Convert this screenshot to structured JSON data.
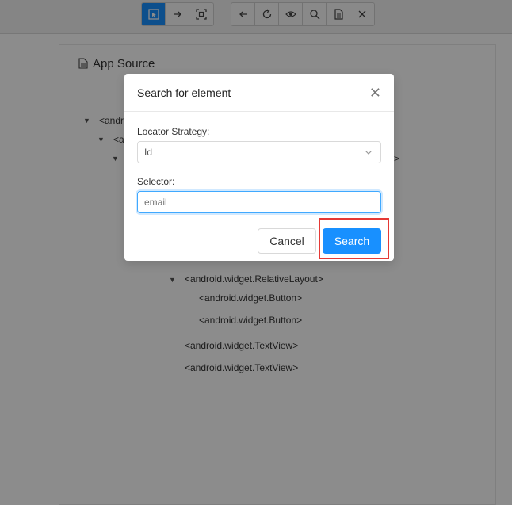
{
  "toolbar": {
    "group1": [
      "select-element-icon",
      "swipe-icon",
      "tap-coordinates-icon"
    ],
    "group2": [
      "back-icon",
      "refresh-icon",
      "show-icon",
      "search-icon",
      "copy-xml-icon",
      "quit-icon"
    ]
  },
  "source_panel": {
    "title": "App Source",
    "tree": [
      {
        "label": "<andro"
      },
      {
        "label": "<a"
      },
      {
        "label": ">"
      },
      {
        "label": "<android.widget.RelativeLayout>"
      },
      {
        "label": "<android.widget.Button>"
      },
      {
        "label": "<android.widget.Button>"
      },
      {
        "label": "<android.widget.TextView>"
      },
      {
        "label": "<android.widget.TextView>"
      }
    ]
  },
  "modal": {
    "title": "Search for element",
    "close_icon": "close-icon",
    "locator_label": "Locator Strategy:",
    "locator_value": "Id",
    "selector_label": "Selector:",
    "selector_value": "email",
    "cancel_label": "Cancel",
    "search_label": "Search"
  },
  "colors": {
    "accent": "#1890ff",
    "highlight": "#e53935",
    "overlay": "rgba(0,0,0,0.45)"
  }
}
